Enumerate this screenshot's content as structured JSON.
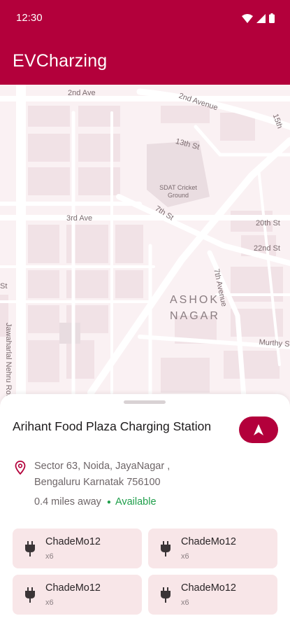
{
  "status_bar": {
    "time": "12:30"
  },
  "app_bar": {
    "title": "EVCharzing"
  },
  "map": {
    "labels": {
      "second_ave_left": "2nd Ave",
      "second_avenue": "2nd Avenue",
      "thirteenth_st": "13th St",
      "fifteenth": "15th",
      "cricket_ground": "SDAT Cricket Ground",
      "third_ave": "3rd Ave",
      "seventh_st": "7th St",
      "twentieth_st": "20th St",
      "twenty_second_st": "22nd St",
      "jawaharlal_road": "Jawaharlal Nehru Road",
      "seventh_avenue": "7th Avenue",
      "ashok": "ASHOK",
      "nagar": "NAGAR",
      "murthy": "Murthy S",
      "st_edge": "St"
    }
  },
  "station": {
    "name": "Arihant Food Plaza Charging Station",
    "address": "Sector 63, Noida, JayaNagar , Bengaluru Karnatak 756100",
    "distance": "0.4 miles away",
    "status": "Available"
  },
  "connectors": [
    {
      "name": "ChadeMo12",
      "count": "x6"
    },
    {
      "name": "ChadeMo12",
      "count": "x6"
    },
    {
      "name": "ChadeMo12",
      "count": "x6"
    },
    {
      "name": "ChadeMo12",
      "count": "x6"
    }
  ],
  "colors": {
    "primary": "#b3003b",
    "available": "#1e9e4a",
    "connector_bg": "#f8e6e8"
  },
  "icons": {
    "navigate": "navigation-arrow-icon",
    "location": "location-pin-icon",
    "plug": "ev-plug-icon"
  }
}
